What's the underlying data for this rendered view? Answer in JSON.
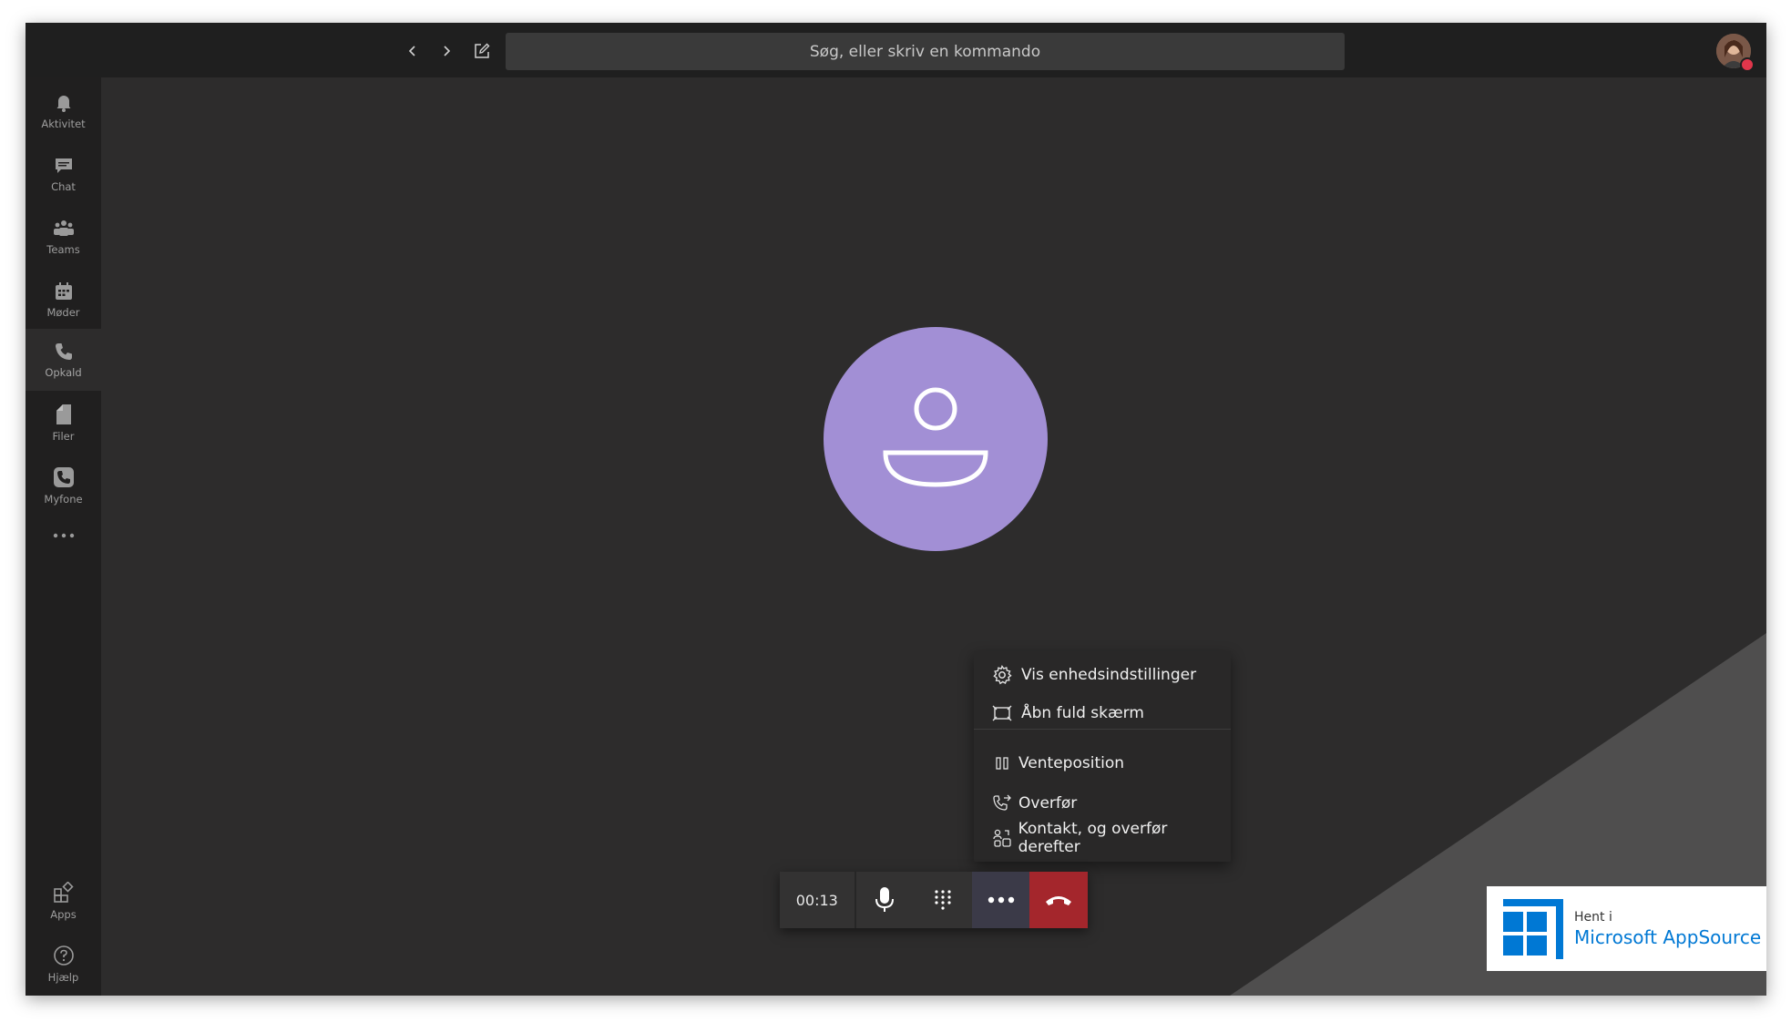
{
  "search": {
    "placeholder": "Søg, eller skriv en kommando"
  },
  "rail": {
    "items": [
      {
        "label": "Aktivitet",
        "icon": "bell-icon"
      },
      {
        "label": "Chat",
        "icon": "chat-icon"
      },
      {
        "label": "Teams",
        "icon": "teams-icon"
      },
      {
        "label": "Møder",
        "icon": "calendar-icon"
      },
      {
        "label": "Opkald",
        "icon": "phone-icon",
        "active": true
      },
      {
        "label": "Filer",
        "icon": "file-icon"
      },
      {
        "label": "Myfone",
        "icon": "myfone-icon"
      }
    ],
    "bottom": [
      {
        "label": "Apps",
        "icon": "apps-icon"
      },
      {
        "label": "Hjælp",
        "icon": "help-icon"
      }
    ]
  },
  "menu": {
    "items": [
      {
        "label": "Vis enhedsindstillinger",
        "icon": "gear-icon"
      },
      {
        "label": "Åbn fuld skærm",
        "icon": "fullscreen-icon"
      },
      {
        "label": "Venteposition",
        "icon": "pause-icon"
      },
      {
        "label": "Overfør",
        "icon": "transfer-icon"
      },
      {
        "label": "Kontakt, og overfør derefter",
        "icon": "consult-transfer-icon"
      }
    ]
  },
  "call": {
    "timer": "00:13"
  },
  "badge": {
    "small": "Hent i",
    "big": "Microsoft AppSource"
  },
  "colors": {
    "accent": "#a28fd5",
    "hangup": "#a4262c",
    "appsource_blue": "#0078d4"
  }
}
